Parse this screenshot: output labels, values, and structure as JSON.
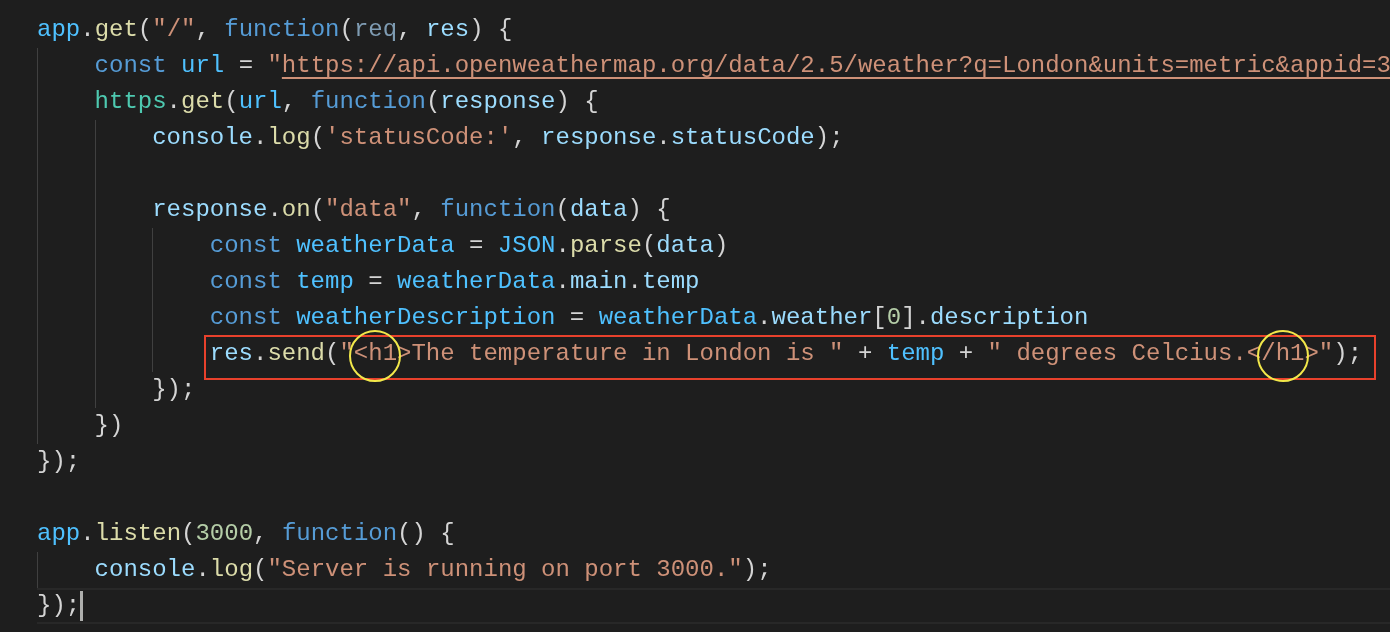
{
  "editor": {
    "lines": [
      {
        "kind": "code",
        "tokens": [
          {
            "kind": "glob",
            "text": "app"
          },
          {
            "kind": "punc",
            "text": "."
          },
          {
            "kind": "fn",
            "text": "get"
          },
          {
            "kind": "punc",
            "text": "("
          },
          {
            "kind": "str",
            "text": "\"/\""
          },
          {
            "kind": "punc",
            "text": ", "
          },
          {
            "kind": "kw",
            "text": "function"
          },
          {
            "kind": "punc",
            "text": "("
          },
          {
            "kind": "unused",
            "text": "req"
          },
          {
            "kind": "punc",
            "text": ", "
          },
          {
            "kind": "var",
            "text": "res"
          },
          {
            "kind": "punc",
            "text": ") {"
          }
        ],
        "children": [
          {
            "kind": "code",
            "tokens": [
              {
                "kind": "kw",
                "text": "const "
              },
              {
                "kind": "glob",
                "text": "url"
              },
              {
                "kind": "punc",
                "text": " = "
              },
              {
                "kind": "str",
                "text": "\""
              },
              {
                "kind": "link",
                "text": "https://api.openweathermap.org/data/2.5/weather?q=London&units=metric&appid=3"
              }
            ]
          },
          {
            "kind": "code",
            "tokens": [
              {
                "kind": "type",
                "text": "https"
              },
              {
                "kind": "punc",
                "text": "."
              },
              {
                "kind": "fn",
                "text": "get"
              },
              {
                "kind": "punc",
                "text": "("
              },
              {
                "kind": "glob",
                "text": "url"
              },
              {
                "kind": "punc",
                "text": ", "
              },
              {
                "kind": "kw",
                "text": "function"
              },
              {
                "kind": "punc",
                "text": "("
              },
              {
                "kind": "var",
                "text": "response"
              },
              {
                "kind": "punc",
                "text": ") {"
              }
            ],
            "children": [
              {
                "kind": "code",
                "tokens": [
                  {
                    "kind": "var",
                    "text": "console"
                  },
                  {
                    "kind": "punc",
                    "text": "."
                  },
                  {
                    "kind": "fn",
                    "text": "log"
                  },
                  {
                    "kind": "punc",
                    "text": "("
                  },
                  {
                    "kind": "str",
                    "text": "'statusCode:'"
                  },
                  {
                    "kind": "punc",
                    "text": ", "
                  },
                  {
                    "kind": "var",
                    "text": "response"
                  },
                  {
                    "kind": "punc",
                    "text": "."
                  },
                  {
                    "kind": "var",
                    "text": "statusCode"
                  },
                  {
                    "kind": "punc",
                    "text": ");"
                  }
                ]
              },
              {
                "kind": "blank"
              },
              {
                "kind": "code",
                "tokens": [
                  {
                    "kind": "var",
                    "text": "response"
                  },
                  {
                    "kind": "punc",
                    "text": "."
                  },
                  {
                    "kind": "fn",
                    "text": "on"
                  },
                  {
                    "kind": "punc",
                    "text": "("
                  },
                  {
                    "kind": "str",
                    "text": "\"data\""
                  },
                  {
                    "kind": "punc",
                    "text": ", "
                  },
                  {
                    "kind": "kw",
                    "text": "function"
                  },
                  {
                    "kind": "punc",
                    "text": "("
                  },
                  {
                    "kind": "var",
                    "text": "data"
                  },
                  {
                    "kind": "punc",
                    "text": ") {"
                  }
                ],
                "children": [
                  {
                    "kind": "code",
                    "tokens": [
                      {
                        "kind": "kw",
                        "text": "const "
                      },
                      {
                        "kind": "glob",
                        "text": "weatherData"
                      },
                      {
                        "kind": "punc",
                        "text": " = "
                      },
                      {
                        "kind": "glob",
                        "text": "JSON"
                      },
                      {
                        "kind": "punc",
                        "text": "."
                      },
                      {
                        "kind": "fn",
                        "text": "parse"
                      },
                      {
                        "kind": "punc",
                        "text": "("
                      },
                      {
                        "kind": "var",
                        "text": "data"
                      },
                      {
                        "kind": "punc",
                        "text": ")"
                      }
                    ]
                  },
                  {
                    "kind": "code",
                    "tokens": [
                      {
                        "kind": "kw",
                        "text": "const "
                      },
                      {
                        "kind": "glob",
                        "text": "temp"
                      },
                      {
                        "kind": "punc",
                        "text": " = "
                      },
                      {
                        "kind": "glob",
                        "text": "weatherData"
                      },
                      {
                        "kind": "punc",
                        "text": "."
                      },
                      {
                        "kind": "var",
                        "text": "main"
                      },
                      {
                        "kind": "punc",
                        "text": "."
                      },
                      {
                        "kind": "var",
                        "text": "temp"
                      }
                    ]
                  },
                  {
                    "kind": "code",
                    "tokens": [
                      {
                        "kind": "kw",
                        "text": "const "
                      },
                      {
                        "kind": "glob",
                        "text": "weatherDescription"
                      },
                      {
                        "kind": "punc",
                        "text": " = "
                      },
                      {
                        "kind": "glob",
                        "text": "weatherData"
                      },
                      {
                        "kind": "punc",
                        "text": "."
                      },
                      {
                        "kind": "var",
                        "text": "weather"
                      },
                      {
                        "kind": "punc",
                        "text": "["
                      },
                      {
                        "kind": "num",
                        "text": "0"
                      },
                      {
                        "kind": "punc",
                        "text": "]."
                      },
                      {
                        "kind": "var",
                        "text": "description"
                      }
                    ]
                  },
                  {
                    "kind": "code",
                    "boxed": true,
                    "tokens": [
                      {
                        "kind": "var",
                        "text": "res"
                      },
                      {
                        "kind": "punc",
                        "text": "."
                      },
                      {
                        "kind": "fn",
                        "text": "send"
                      },
                      {
                        "kind": "punc",
                        "text": "("
                      },
                      {
                        "kind": "str",
                        "text": "\""
                      },
                      {
                        "kind": "str",
                        "text": "<h1",
                        "circled": true
                      },
                      {
                        "kind": "str",
                        "text": ">The temperature in London is \""
                      },
                      {
                        "kind": "punc",
                        "text": " + "
                      },
                      {
                        "kind": "glob",
                        "text": "temp"
                      },
                      {
                        "kind": "punc",
                        "text": " + "
                      },
                      {
                        "kind": "str",
                        "text": "\" degrees Celcius.<"
                      },
                      {
                        "kind": "str",
                        "text": "/h1",
                        "circled": true
                      },
                      {
                        "kind": "str",
                        "text": ">\""
                      },
                      {
                        "kind": "punc",
                        "text": ");"
                      }
                    ]
                  }
                ]
              },
              {
                "kind": "code",
                "tokens": [
                  {
                    "kind": "punc",
                    "text": "});"
                  }
                ]
              }
            ]
          },
          {
            "kind": "code",
            "tokens": [
              {
                "kind": "punc",
                "text": "})"
              }
            ]
          }
        ]
      },
      {
        "kind": "code",
        "tokens": [
          {
            "kind": "punc",
            "text": "});"
          }
        ]
      },
      {
        "kind": "blank"
      },
      {
        "kind": "code",
        "tokens": [
          {
            "kind": "glob",
            "text": "app"
          },
          {
            "kind": "punc",
            "text": "."
          },
          {
            "kind": "fn",
            "text": "listen"
          },
          {
            "kind": "punc",
            "text": "("
          },
          {
            "kind": "num",
            "text": "3000"
          },
          {
            "kind": "punc",
            "text": ", "
          },
          {
            "kind": "kw",
            "text": "function"
          },
          {
            "kind": "punc",
            "text": "() {"
          }
        ],
        "children": [
          {
            "kind": "code",
            "tokens": [
              {
                "kind": "var",
                "text": "console"
              },
              {
                "kind": "punc",
                "text": "."
              },
              {
                "kind": "fn",
                "text": "log"
              },
              {
                "kind": "punc",
                "text": "("
              },
              {
                "kind": "str",
                "text": "\"Server is running on port 3000.\""
              },
              {
                "kind": "punc",
                "text": ");"
              }
            ]
          }
        ]
      },
      {
        "kind": "code",
        "current": true,
        "tokens": [
          {
            "kind": "punc",
            "text": "});"
          }
        ]
      }
    ]
  }
}
